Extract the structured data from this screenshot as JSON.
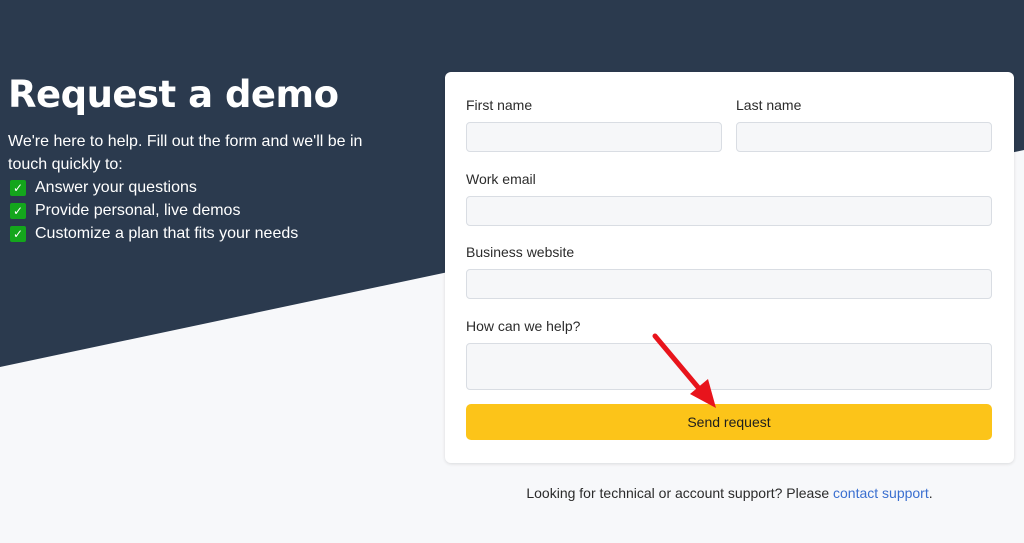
{
  "hero": {
    "title": "Request a demo",
    "intro": "We're here to help. Fill out the form and we'll be in touch quickly to:",
    "benefits": [
      "Answer your questions",
      "Provide personal, live demos",
      "Customize a plan that fits your needs"
    ],
    "check_icon": "✓"
  },
  "form": {
    "first_name_label": "First name",
    "last_name_label": "Last name",
    "work_email_label": "Work email",
    "business_website_label": "Business website",
    "help_label": "How can we help?",
    "first_name_value": "",
    "last_name_value": "",
    "work_email_value": "",
    "business_website_value": "",
    "help_value": "",
    "submit_label": "Send request"
  },
  "footer": {
    "text": "Looking for technical or account support? Please ",
    "link": "contact support",
    "suffix": "."
  },
  "colors": {
    "hero_bg": "#2b3a4e",
    "page_bg": "#f7f8fa",
    "submit_bg": "#fcc419",
    "check_bg": "#14a61c",
    "link": "#3a6fd0",
    "annotation_arrow": "#e8141c"
  }
}
